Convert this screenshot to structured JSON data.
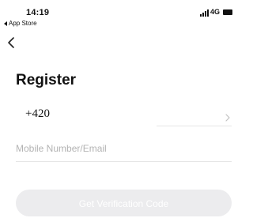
{
  "status_bar": {
    "time": "14:19",
    "back_to_app": "App Store",
    "network": "4G"
  },
  "icons": {
    "back": "chevron-left-icon",
    "country_picker": "chevron-right-icon"
  },
  "page": {
    "title": "Register"
  },
  "form": {
    "country_code": "+420",
    "phone_placeholder": "Mobile Number/Email",
    "phone_value": ""
  },
  "actions": {
    "verify_label": "Get Verification Code"
  }
}
